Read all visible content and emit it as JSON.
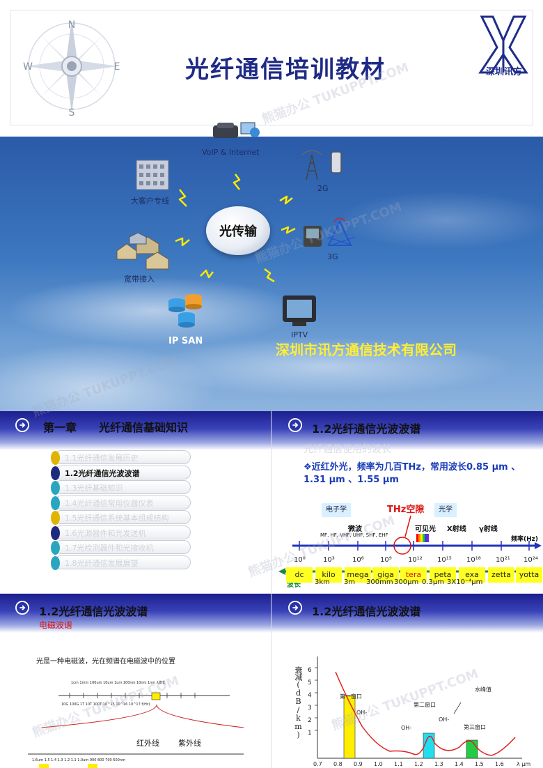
{
  "slide1": {
    "title": "光纤通信培训教材",
    "logo_text": "深圳讯方",
    "compass": [
      "N",
      "S",
      "W",
      "E"
    ],
    "hub_label": "光传输",
    "nodes": {
      "voip": "VoIP & Internet",
      "bigclient": "大客户专线",
      "g2": "2G",
      "g3": "3G",
      "broadband": "宽带接入",
      "ipsan": "IP SAN",
      "iptv": "IPTV"
    },
    "company": "深圳市讯方通信技术有限公司"
  },
  "slide2": {
    "chapter": "第一章",
    "title": "光纤通信基础知识",
    "toc": [
      {
        "label": "1.1光纤通信发展历史",
        "active": false,
        "color": "#e0b400"
      },
      {
        "label": "1.2光纤通信光波波谱",
        "active": true,
        "color": "#1e2a7e"
      },
      {
        "label": "1.3光纤基础知识",
        "active": false,
        "color": "#2aa5c0"
      },
      {
        "label": "1.4光纤通信常用仪器仪表",
        "active": false,
        "color": "#2aa5c0"
      },
      {
        "label": "1.5光纤通信系统基本组成结构",
        "active": false,
        "color": "#e0b400"
      },
      {
        "label": "1.6光源器件和光发送机",
        "active": false,
        "color": "#1e2a7e"
      },
      {
        "label": "1.7光检测器件和光接收机",
        "active": false,
        "color": "#2aa5c0"
      },
      {
        "label": "1.8光纤通信发展展望",
        "active": false,
        "color": "#2aa5c0"
      }
    ]
  },
  "slide3": {
    "title": "1.2光纤通信光波波谱",
    "subtitle": "光纤通信使用的波长",
    "bullet": "近红外光，频率为几百THz，常用波长0.85 μm 、1.31 μm 、1.55 μm",
    "bands_top": [
      "电子学",
      "光学"
    ],
    "thz_label": "THz空隙",
    "bands": [
      "微波",
      "可见光",
      "X射线",
      "γ射线"
    ],
    "microwave_sub": "MF, HF, VHF, UHF, SHF, EHF",
    "freq_label": "频率(Hz)",
    "freq_unit": "Hz",
    "exponents": [
      "10⁰",
      "10³",
      "10⁶",
      "10⁹",
      "10¹²",
      "10¹⁵",
      "10¹⁸",
      "10²¹",
      "10²⁴"
    ],
    "prefixes": [
      "dc",
      "kilo",
      "mega",
      "giga",
      "tera",
      "peta",
      "exa",
      "zetta",
      "yotta"
    ],
    "wavelength_label": "波长",
    "wavelengths": [
      "3km",
      "3m",
      "300mm",
      "300μm",
      "0.3μm",
      "3X10⁻⁴μm"
    ]
  },
  "slide4": {
    "title": "1.2光纤通信光波波谱",
    "subtitle": "电磁波谱",
    "desc": "光是一种电磁波，光在频谱在电磁波中的位置",
    "scale_top": "1cm 1mm 100um 10um 1um 100nm 10nm 1nm λ波长",
    "scale_bottom": "10G 100G 1T 10T 100T 10^15 10^16 10^17 f(Hz)",
    "ir": "红外线",
    "uv": "紫外线",
    "scale_ir": "1.6um 1.5 1.4 1.3 1.2 1.1 1.0um 900 800 700 600nm"
  },
  "slide5": {
    "title": "1.2光纤通信光波波谱",
    "ylabel": "衰减(dB/km)",
    "yticks": [
      "6",
      "5",
      "4",
      "3",
      "2",
      "1"
    ],
    "labels": {
      "w1": "第一窗口",
      "w2": "第二窗口",
      "w3": "第三窗口",
      "oh": "OH-",
      "peak": "水峰值"
    },
    "xticks": [
      "0.7",
      "0.8",
      "0.9",
      "1.0",
      "1.1",
      "1.2",
      "1.3",
      "1.4",
      "1.5",
      "1.6"
    ],
    "xunit": "λ μm"
  },
  "watermark": "熊猫办公 TUKUPPT.COM",
  "colors": {
    "title_blue": "#1e2a86",
    "header_gradient_top": "#1c1f8e",
    "company_yellow": "#ffee33",
    "thz_red": "#e01010",
    "axis_blue": "#2233bb",
    "axis_green": "#1a8a3a",
    "curve_red": "#e02020"
  }
}
